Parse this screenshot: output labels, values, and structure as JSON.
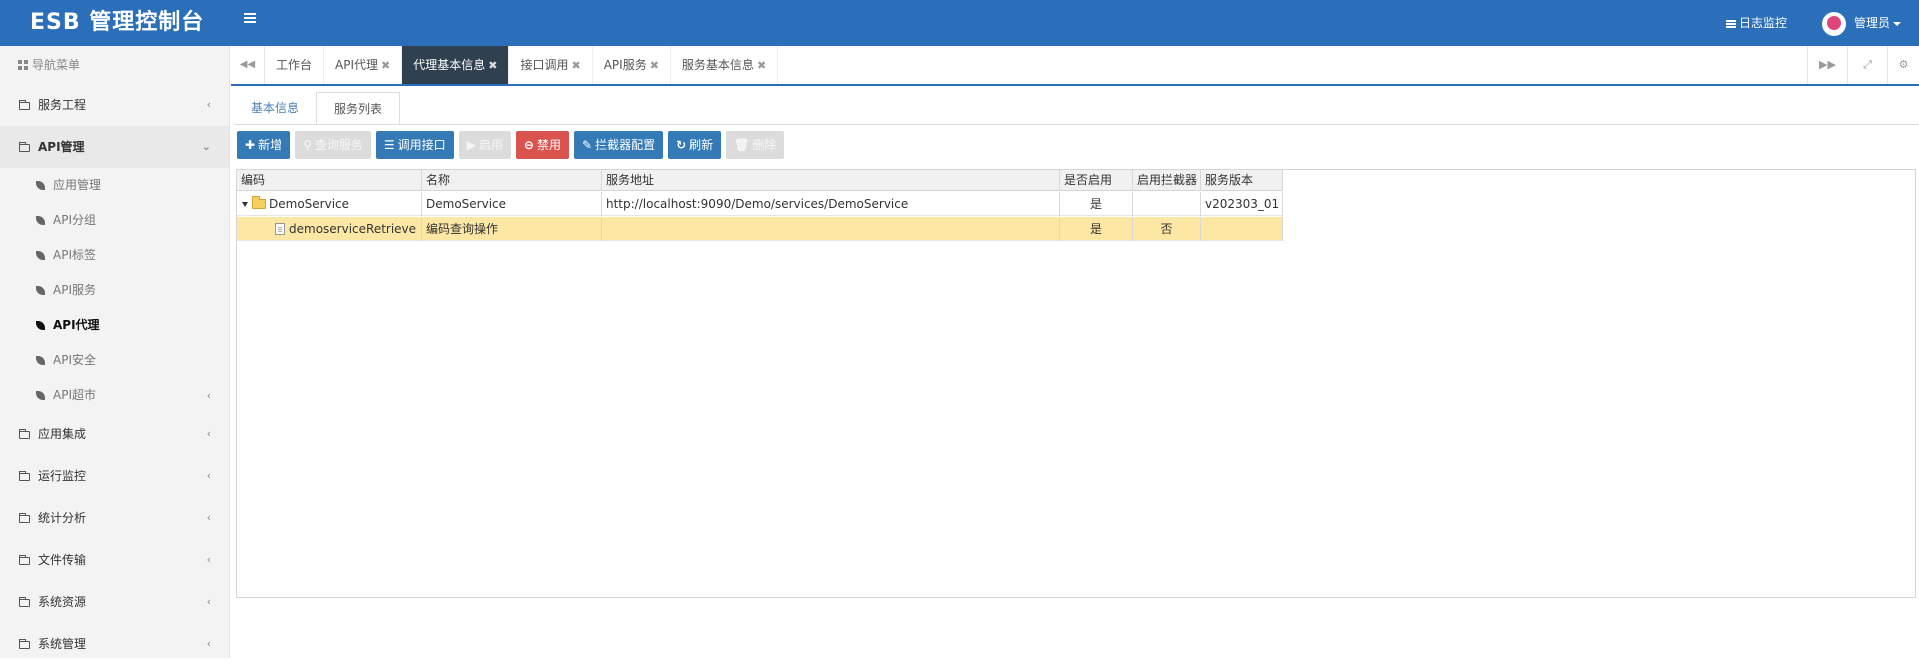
{
  "topbar": {
    "brand": "ESB 管理控制台",
    "log_monitor": "日志监控",
    "user": "管理员",
    "color": "#2b6fba"
  },
  "sidebar": {
    "header": "导航菜单",
    "items": [
      {
        "label": "服务工程",
        "icon": "folder-icon"
      },
      {
        "label": "API管理",
        "icon": "folder-icon",
        "expanded": true
      },
      {
        "label": "应用集成",
        "icon": "folder-icon"
      },
      {
        "label": "运行监控",
        "icon": "folder-icon"
      },
      {
        "label": "统计分析",
        "icon": "folder-icon"
      },
      {
        "label": "文件传输",
        "icon": "folder-icon"
      },
      {
        "label": "系统资源",
        "icon": "folder-icon"
      },
      {
        "label": "系统管理",
        "icon": "folder-icon"
      }
    ],
    "api_sub": [
      {
        "label": "应用管理"
      },
      {
        "label": "API分组"
      },
      {
        "label": "API标签"
      },
      {
        "label": "API服务"
      },
      {
        "label": "API代理",
        "active": true
      },
      {
        "label": "API安全"
      },
      {
        "label": "API超市"
      }
    ]
  },
  "tabs": [
    {
      "label": "工作台",
      "closable": false
    },
    {
      "label": "API代理",
      "closable": true
    },
    {
      "label": "代理基本信息",
      "closable": true,
      "active": true
    },
    {
      "label": "接口调用",
      "closable": true
    },
    {
      "label": "API服务",
      "closable": true
    },
    {
      "label": "服务基本信息",
      "closable": true
    }
  ],
  "subtabs": [
    {
      "label": "基本信息"
    },
    {
      "label": "服务列表",
      "active": true
    }
  ],
  "toolbar": [
    {
      "label": "新增",
      "icon": "plus-icon",
      "style": "blue"
    },
    {
      "label": "查询服务",
      "icon": "search-icon",
      "style": "disabled"
    },
    {
      "label": "调用接口",
      "icon": "list-icon",
      "style": "blue"
    },
    {
      "label": "启用",
      "icon": "play-icon",
      "style": "disabled"
    },
    {
      "label": "禁用",
      "icon": "minus-circle-icon",
      "style": "red"
    },
    {
      "label": "拦截器配置",
      "icon": "edit-icon",
      "style": "blue"
    },
    {
      "label": "刷新",
      "icon": "refresh-icon",
      "style": "blue"
    },
    {
      "label": "删除",
      "icon": "trash-icon",
      "style": "disabled"
    }
  ],
  "grid": {
    "columns": [
      "编码",
      "名称",
      "服务地址",
      "是否启用",
      "启用拦截器",
      "服务版本"
    ],
    "rows": [
      {
        "code": "DemoService",
        "name": "DemoService",
        "url": "http://localhost:9090/Demo/services/DemoService",
        "enabled": "是",
        "interceptor": "",
        "version": "v202303_01",
        "type": "folder"
      },
      {
        "code": "demoserviceRetrieve",
        "name": "编码查询操作",
        "url": "",
        "enabled": "是",
        "interceptor": "否",
        "version": "",
        "type": "file",
        "selected": true
      }
    ]
  }
}
